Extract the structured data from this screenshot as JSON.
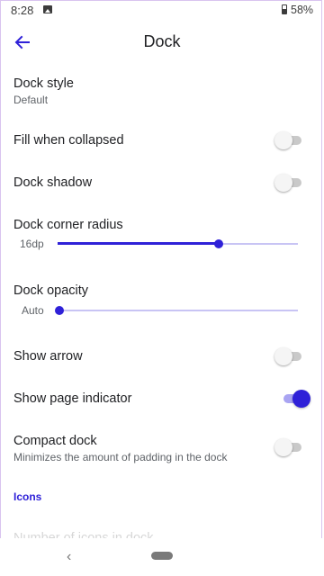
{
  "status_bar": {
    "time": "8:28",
    "battery_pct": "58%",
    "battery_level": 0.58
  },
  "app_bar": {
    "title": "Dock"
  },
  "settings": {
    "dock_style": {
      "label": "Dock style",
      "value": "Default"
    },
    "fill_when_collapsed": {
      "label": "Fill when collapsed",
      "enabled": false
    },
    "dock_shadow": {
      "label": "Dock shadow",
      "enabled": false
    },
    "dock_corner_radius": {
      "label": "Dock corner radius",
      "value_label": "16dp",
      "fraction": 0.67
    },
    "dock_opacity": {
      "label": "Dock opacity",
      "value_label": "Auto",
      "fraction": 0.0
    },
    "show_arrow": {
      "label": "Show arrow",
      "enabled": false
    },
    "show_page_indicator": {
      "label": "Show page indicator",
      "enabled": true
    },
    "compact_dock": {
      "label": "Compact dock",
      "summary": "Minimizes the amount of padding in the dock",
      "enabled": false
    }
  },
  "sections": {
    "icons_header": "Icons",
    "icons_first_item": "Number of icons in dock"
  },
  "colors": {
    "accent": "#2f21d8",
    "accent_light": "#a9a4f2",
    "switch_off_track": "#c9c9c9"
  }
}
